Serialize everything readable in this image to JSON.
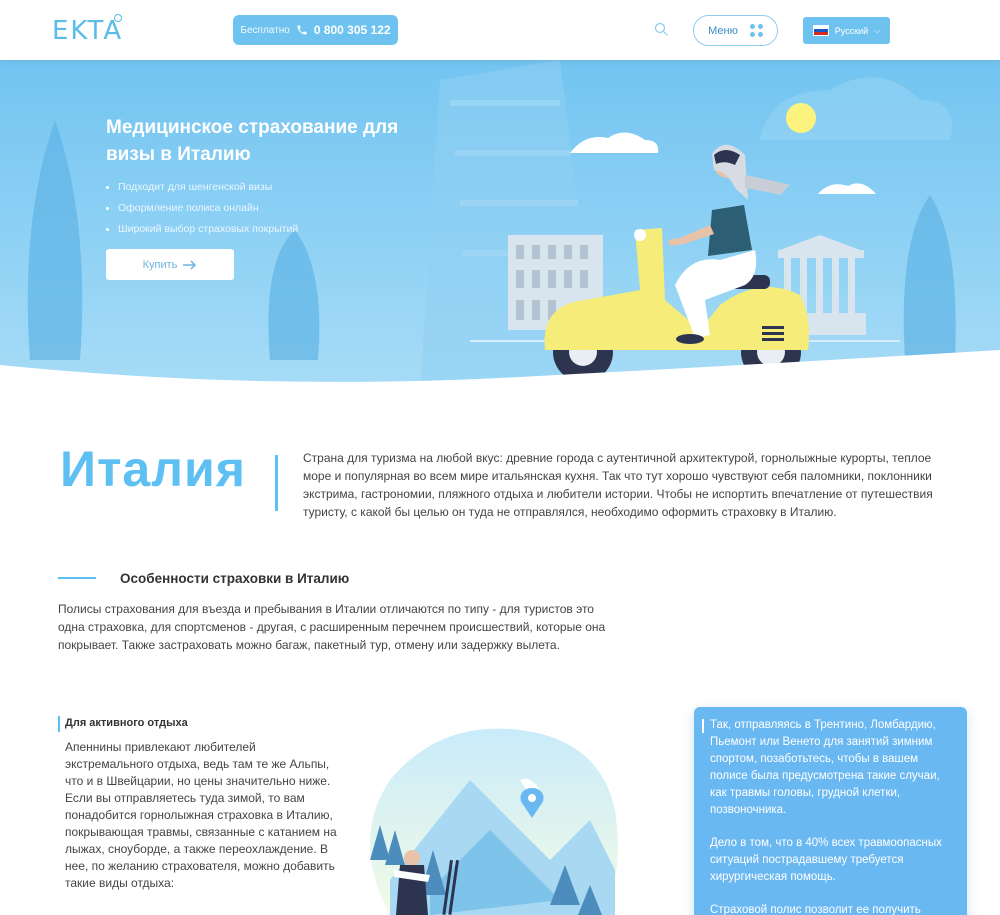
{
  "header": {
    "logo": "EKTA",
    "phone_free": "Бесплатно",
    "phone_number": "0 800 305 122",
    "menu_label": "Меню",
    "language": "Русский"
  },
  "hero": {
    "title": "Медицинское страхование для визы в Италию",
    "bullets": [
      "Подходит для шенгенской визы",
      "Оформление полиса онлайн",
      "Широкий выбор страховых покрытий"
    ],
    "buy_label": "Купить"
  },
  "italy": {
    "title": "Италия",
    "text": "Страна для туризма на любой вкус: древние города с аутентичной архитектурой, горнолыжные курорты, теплое море и популярная во всем мире итальянская кухня. Так что тут хорошо чувствуют себя паломники, поклонники экстрима, гастрономии, пляжного отдыха и любители истории. Чтобы не испортить впечатление от путешествия туристу, с какой бы целью он туда не отправлялся, необходимо оформить страховку в Италию."
  },
  "features": {
    "title": "Особенности страховки в Италию",
    "text": "Полисы страхования для въезда и пребывания в Италии отличаются по типу - для туристов это одна страховка, для спортсменов - другая, с расширенным перечнем происшествий, которые она покрывает. Также застраховать можно багаж, пакетный тур, отмену или задержку вылета."
  },
  "active": {
    "title": "Для активного отдыха",
    "text": "Апеннины привлекают любителей экстремального отдыха, ведь там те же Альпы, что и в Швейцарии, но цены значительно ниже. Если вы отправляетесь туда зимой, то вам понадобится горнолыжная страховка в Италию, покрывающая травмы, связанные с катанием на лыжах, сноуборде, а также переохлаждение. В нее, по желанию страхователя, можно добавить такие виды отдыха:"
  },
  "card": {
    "p1": "Так, отправляясь в Трентино, Ломбардию, Пьемонт или Венето для занятий зимним спортом, позаботьтесь, чтобы в вашем полисе была предусмотрена такие случаи, как травмы головы, грудной клетки, позвоночника.",
    "p2": "Дело в том, что в 40% всех травмоопасных ситуаций пострадавшему требуется хирургическая помощь.",
    "p3": "Страховой полис позволит ее получить"
  },
  "colors": {
    "accent": "#5ec0f2",
    "hero_sky": "#7ecbf2",
    "scooter": "#f5ec7a"
  }
}
